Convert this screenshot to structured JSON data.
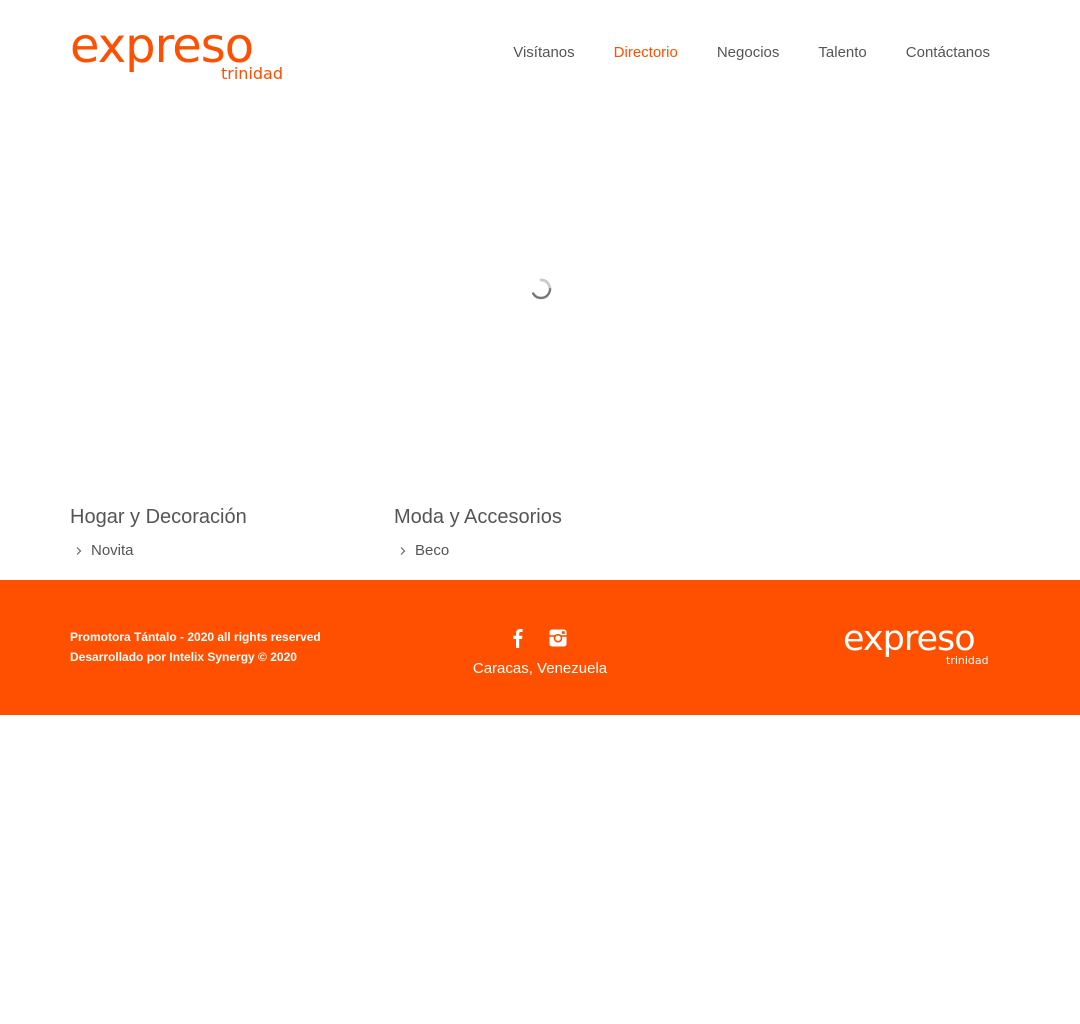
{
  "brand": {
    "name": "expreso",
    "subtitle": "trinidad",
    "accent": "#ff4f00"
  },
  "nav": {
    "items": [
      {
        "label": "Visítanos",
        "active": false
      },
      {
        "label": "Directorio",
        "active": true
      },
      {
        "label": "Negocios",
        "active": false
      },
      {
        "label": "Talento",
        "active": false
      },
      {
        "label": "Contáctanos",
        "active": false
      }
    ]
  },
  "loader": {
    "icon": "loading-spinner-icon"
  },
  "categories": [
    {
      "title": "Hogar y Decoración",
      "items": [
        "Novita"
      ]
    },
    {
      "title": "Moda y Accesorios",
      "items": [
        "Beco"
      ]
    }
  ],
  "footer": {
    "copyright": "Promotora Tántalo - 2020 all rights reserved",
    "developer": "Desarrollado por Intelix Synergy © 2020",
    "social": [
      "facebook-icon",
      "instagram-icon"
    ],
    "location": "Caracas, Venezuela",
    "background": "#ff4f00"
  }
}
